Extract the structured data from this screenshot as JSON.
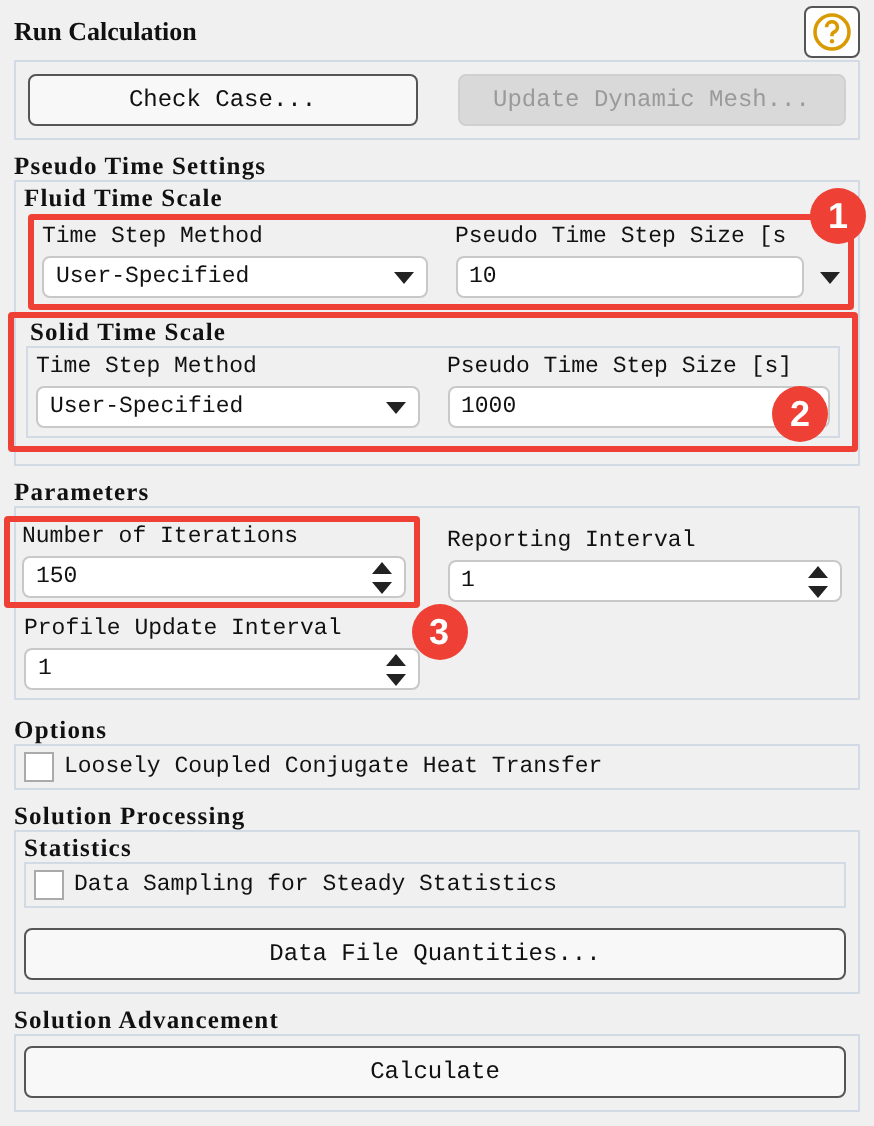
{
  "title": "Run Calculation",
  "buttons": [
    {
      "label": "Check Case...",
      "disabled": false
    },
    {
      "label": "Update Dynamic Mesh...",
      "disabled": true
    }
  ],
  "pseudo_time_settings": {
    "title": "Pseudo Time Settings",
    "groups": [
      {
        "title": "Fluid Time Scale",
        "fields": [
          {
            "label": "Time Step Method",
            "value": "User-Specified",
            "kind": "dropdown"
          },
          {
            "label": "Pseudo Time Step Size [s",
            "value": "10",
            "kind": "combo"
          }
        ]
      },
      {
        "title": "Solid Time Scale",
        "fields": [
          {
            "label": "Time Step Method",
            "value": "User-Specified",
            "kind": "dropdown"
          },
          {
            "label": "Pseudo Time Step Size [s]",
            "value": "1000",
            "kind": "text"
          }
        ]
      }
    ]
  },
  "parameters": {
    "title": "Parameters",
    "fields": [
      {
        "label": "Number of Iterations",
        "value": "150",
        "kind": "spinner"
      },
      {
        "label": "Reporting Interval",
        "value": "1",
        "kind": "spinner"
      },
      {
        "label": "Profile Update Interval",
        "value": "1",
        "kind": "spinner"
      }
    ]
  },
  "options": {
    "title": "Options",
    "checkboxes": [
      {
        "label": "Loosely Coupled Conjugate Heat Transfer",
        "checked": false
      }
    ]
  },
  "solution_processing": {
    "title": "Solution Processing",
    "statistics": {
      "title": "Statistics",
      "checkbox": {
        "label": "Data Sampling for Steady Statistics",
        "checked": false
      }
    },
    "button": "Data File Quantities..."
  },
  "solution_advancement": {
    "title": "Solution Advancement",
    "button": "Calculate"
  },
  "annotations": [
    {
      "label": "1"
    },
    {
      "label": "2"
    },
    {
      "label": "3"
    }
  ]
}
